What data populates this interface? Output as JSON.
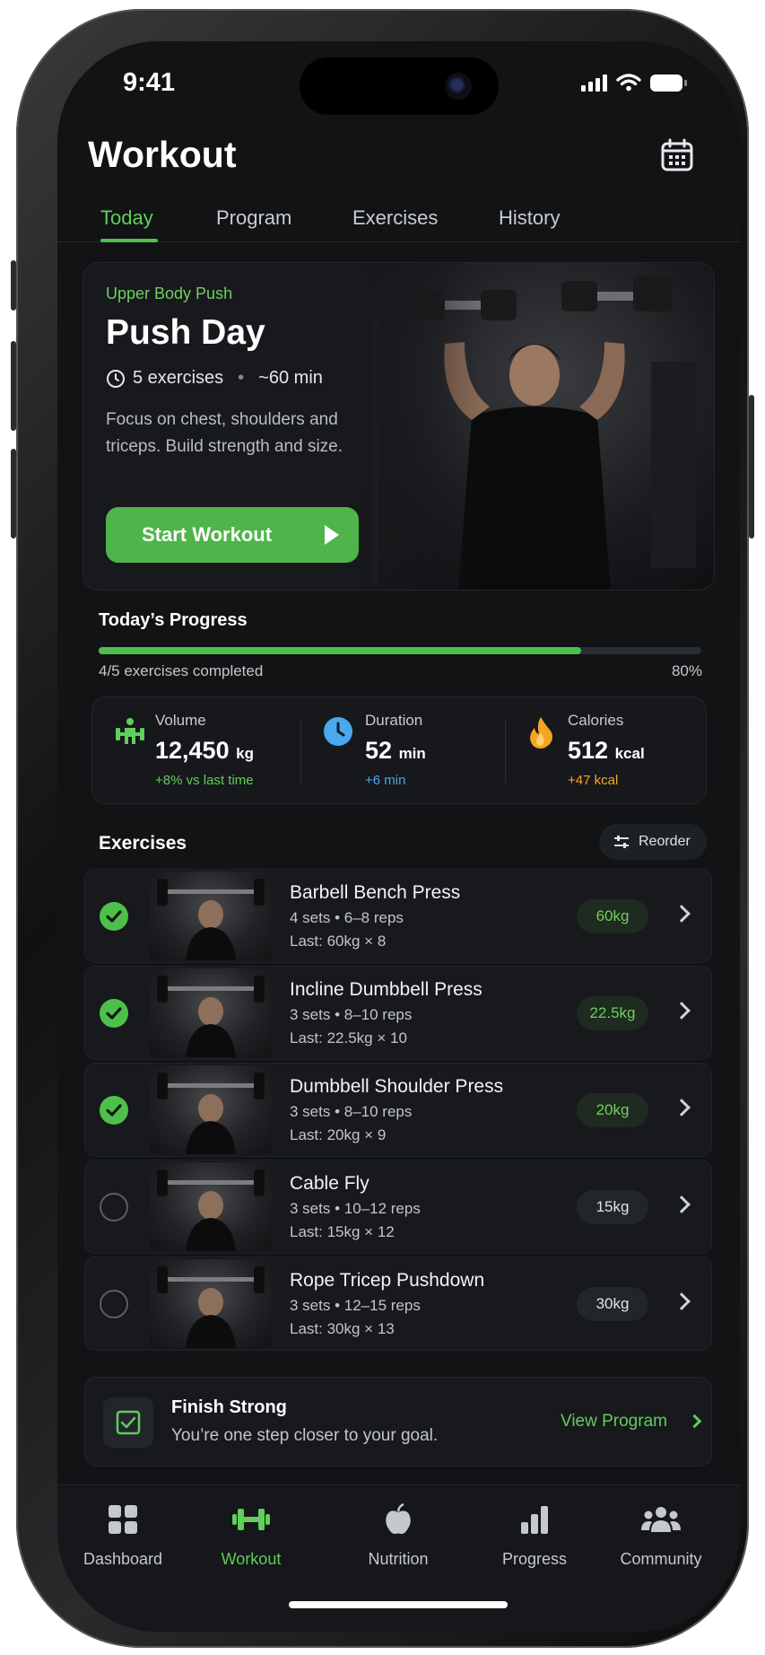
{
  "status": {
    "time": "9:41"
  },
  "header": {
    "title": "Workout",
    "calendar_icon": "calendar-icon"
  },
  "tabs": [
    {
      "label": "Today",
      "active": true
    },
    {
      "label": "Program",
      "active": false
    },
    {
      "label": "Exercises",
      "active": false
    },
    {
      "label": "History",
      "active": false
    }
  ],
  "hero": {
    "subtitle": "Upper Body Push",
    "title": "Push Day",
    "exercises": "5 exercises",
    "duration": "~60 min",
    "description": "Focus on chest, shoulders and triceps. Build strength and size.",
    "button": "Start Workout"
  },
  "progress": {
    "title": "Today’s Progress",
    "completed_text": "4/5 exercises completed",
    "percent_label": "80%",
    "fraction": 0.8
  },
  "stats": [
    {
      "label": "Volume",
      "value": "12,450",
      "unit": "kg",
      "delta": "+8% vs last time",
      "color": "#5fce5a",
      "icon": "dumbbell-person-icon"
    },
    {
      "label": "Duration",
      "value": "52",
      "unit": "min",
      "delta": "+6 min",
      "color": "#4aa8ef",
      "icon": "clock-icon"
    },
    {
      "label": "Calories",
      "value": "512",
      "unit": "kcal",
      "delta": "+47 kcal",
      "color": "#f5a524",
      "icon": "flame-icon"
    }
  ],
  "exercises_section": {
    "title": "Exercises",
    "reorder": "Reorder"
  },
  "exercises": [
    {
      "name": "Barbell Bench Press",
      "sets": "4 sets",
      "reps": "6–8 reps",
      "last": "Last: 60kg × 8",
      "weight": "60kg",
      "done": true
    },
    {
      "name": "Incline Dumbbell Press",
      "sets": "3 sets",
      "reps": "8–10 reps",
      "last": "Last: 22.5kg × 10",
      "weight": "22.5kg",
      "done": true
    },
    {
      "name": "Dumbbell Shoulder Press",
      "sets": "3 sets",
      "reps": "8–10 reps",
      "last": "Last: 20kg × 9",
      "weight": "20kg",
      "done": true
    },
    {
      "name": "Cable Fly",
      "sets": "3 sets",
      "reps": "10–12 reps",
      "last": "Last: 15kg × 12",
      "weight": "15kg",
      "done": false
    },
    {
      "name": "Rope Tricep Pushdown",
      "sets": "3 sets",
      "reps": "12–15 reps",
      "last": "Last: 30kg × 13",
      "weight": "30kg",
      "done": false
    }
  ],
  "finish": {
    "title": "Finish Strong",
    "subtitle": "You’re one step closer to your goal.",
    "link": "View Program"
  },
  "nav": [
    {
      "label": "Dashboard",
      "icon": "grid-icon",
      "active": false
    },
    {
      "label": "Workout",
      "icon": "dumbbell-icon",
      "active": true
    },
    {
      "label": "Nutrition",
      "icon": "apple-icon",
      "active": false
    },
    {
      "label": "Progress",
      "icon": "bar-chart-icon",
      "active": false
    },
    {
      "label": "Community",
      "icon": "people-icon",
      "active": false
    }
  ],
  "colors": {
    "accent": "#4fbf4c",
    "background": "#111315",
    "card": "#17191c"
  }
}
